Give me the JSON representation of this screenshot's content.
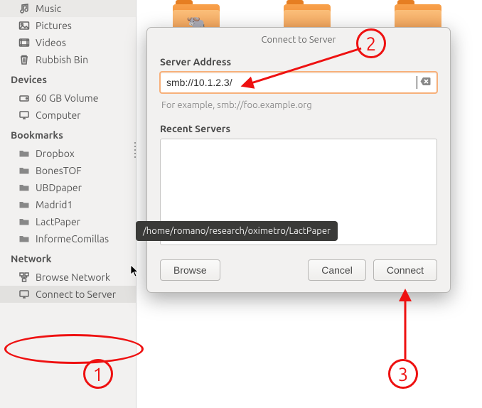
{
  "sidebar": {
    "places": [
      {
        "label": "Music",
        "icon": "music-icon"
      },
      {
        "label": "Pictures",
        "icon": "pictures-icon"
      },
      {
        "label": "Videos",
        "icon": "videos-icon"
      },
      {
        "label": "Rubbish Bin",
        "icon": "trash-icon"
      }
    ],
    "devices_header": "Devices",
    "devices": [
      {
        "label": "60 GB Volume",
        "icon": "drive-icon"
      },
      {
        "label": "Computer",
        "icon": "computer-icon"
      }
    ],
    "bookmarks_header": "Bookmarks",
    "bookmarks": [
      {
        "label": "Dropbox"
      },
      {
        "label": "BonesTOF"
      },
      {
        "label": "UBDpaper"
      },
      {
        "label": "Madrid1"
      },
      {
        "label": "LactPaper"
      },
      {
        "label": "InformeComillas"
      }
    ],
    "network_header": "Network",
    "network": [
      {
        "label": "Browse Network",
        "icon": "network-icon"
      },
      {
        "label": "Connect to Server",
        "icon": "server-icon"
      }
    ]
  },
  "dialog": {
    "title": "Connect to Server",
    "server_address_label": "Server Address",
    "server_address_value": "smb://10.1.2.3/",
    "example_text": "For example, smb://foo.example.org",
    "recent_label": "Recent Servers",
    "browse_label": "Browse",
    "cancel_label": "Cancel",
    "connect_label": "Connect"
  },
  "tooltip": {
    "text": "/home/romano/research/oximetro/LactPaper"
  },
  "annotations": {
    "n1": "1",
    "n2": "2",
    "n3": "3"
  }
}
